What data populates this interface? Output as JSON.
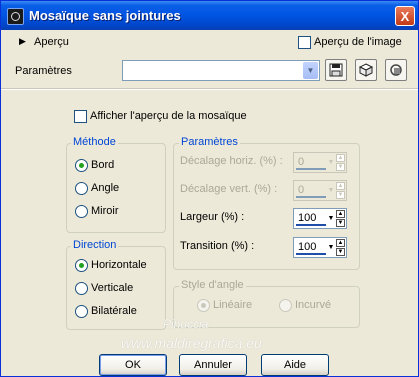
{
  "window": {
    "title": "Mosaïque sans jointures",
    "close_glyph": "X"
  },
  "apercu": {
    "label": "Aperçu",
    "image_checkbox_label": "Aperçu de l'image",
    "image_checked": false
  },
  "presets": {
    "label": "Paramètres",
    "value": ""
  },
  "show_preview": {
    "label": "Afficher l'aperçu de la mosaïque",
    "checked": false
  },
  "methode": {
    "legend": "Méthode",
    "options": [
      {
        "label": "Bord",
        "selected": true
      },
      {
        "label": "Angle",
        "selected": false
      },
      {
        "label": "Miroir",
        "selected": false
      }
    ]
  },
  "direction": {
    "legend": "Direction",
    "options": [
      {
        "label": "Horizontale",
        "selected": true
      },
      {
        "label": "Verticale",
        "selected": false
      },
      {
        "label": "Bilatérale",
        "selected": false
      }
    ]
  },
  "parametres": {
    "legend": "Paramètres",
    "fields": [
      {
        "label": "Décalage horiz. (%) :",
        "value": "0",
        "enabled": false
      },
      {
        "label": "Décalage vert. (%) :",
        "value": "0",
        "enabled": false
      },
      {
        "label": "Largeur (%) :",
        "value": "100",
        "enabled": true
      },
      {
        "label": "Transition (%) :",
        "value": "100",
        "enabled": true
      }
    ]
  },
  "style_angle": {
    "legend": "Style d'angle",
    "options": [
      {
        "label": "Linéaire",
        "selected": true,
        "enabled": false
      },
      {
        "label": "Incurvé",
        "selected": false,
        "enabled": false
      }
    ]
  },
  "buttons": {
    "ok": "OK",
    "cancel": "Annuler",
    "help": "Aide"
  },
  "watermark": {
    "line1": "Pinuccia",
    "line2": "www.maldiregrafica.eu"
  },
  "icons": {
    "expand": "triangle-right-icon",
    "save": "save-preset-icon",
    "randomize": "dice-icon",
    "reset": "reset-icon",
    "spin_up": "arrow-up-icon",
    "spin_down": "arrow-down-icon"
  },
  "colors": {
    "title_bar": "#0054e3",
    "dialog_bg": "#ece9d8",
    "group_legend": "#0046d5",
    "radio_dot": "#21a121"
  }
}
